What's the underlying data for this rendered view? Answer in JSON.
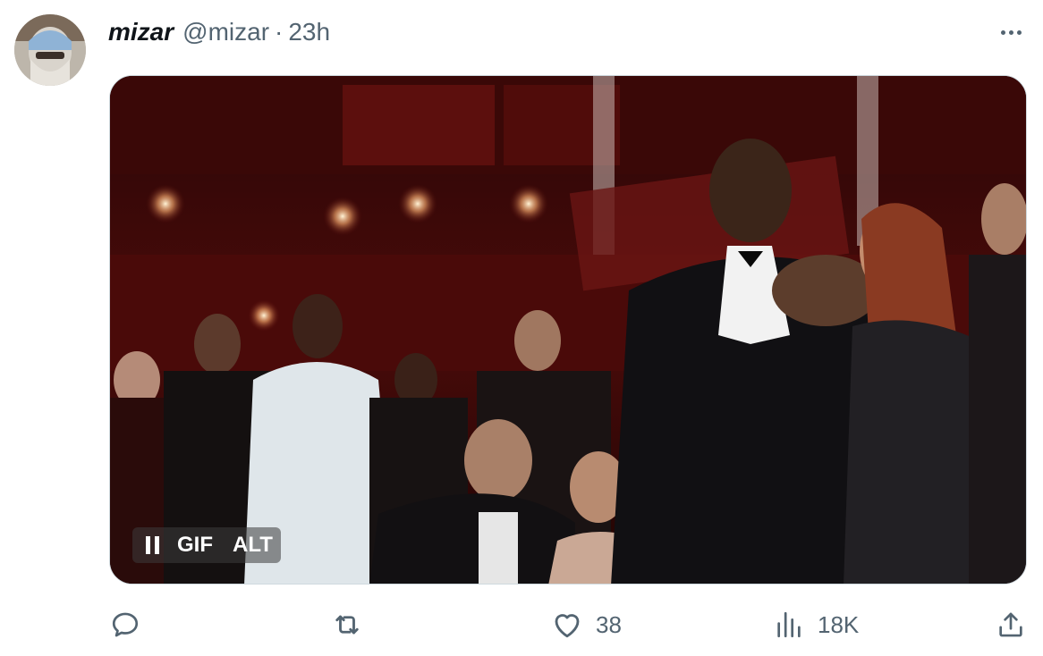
{
  "tweet": {
    "display_name": "mizar",
    "handle": "@mizar",
    "separator": "·",
    "timestamp": "23h",
    "avatar_icon": "masked-person-avatar",
    "more_icon": "ellipsis-icon"
  },
  "media": {
    "type": "gif",
    "description": "animated gif of an audience applauding at an awards ceremony",
    "playback": "playing",
    "pause_icon": "pause-icon",
    "gif_badge": "GIF",
    "alt_badge": "ALT"
  },
  "actions": {
    "reply": {
      "icon": "reply-icon",
      "count": ""
    },
    "retweet": {
      "icon": "retweet-icon",
      "count": ""
    },
    "like": {
      "icon": "heart-icon",
      "count": "38"
    },
    "views": {
      "icon": "analytics-icon",
      "count": "18K"
    },
    "share": {
      "icon": "share-icon",
      "count": ""
    }
  },
  "colors": {
    "text_primary": "#0f1419",
    "text_secondary": "#536471",
    "border": "#cfd9de"
  }
}
